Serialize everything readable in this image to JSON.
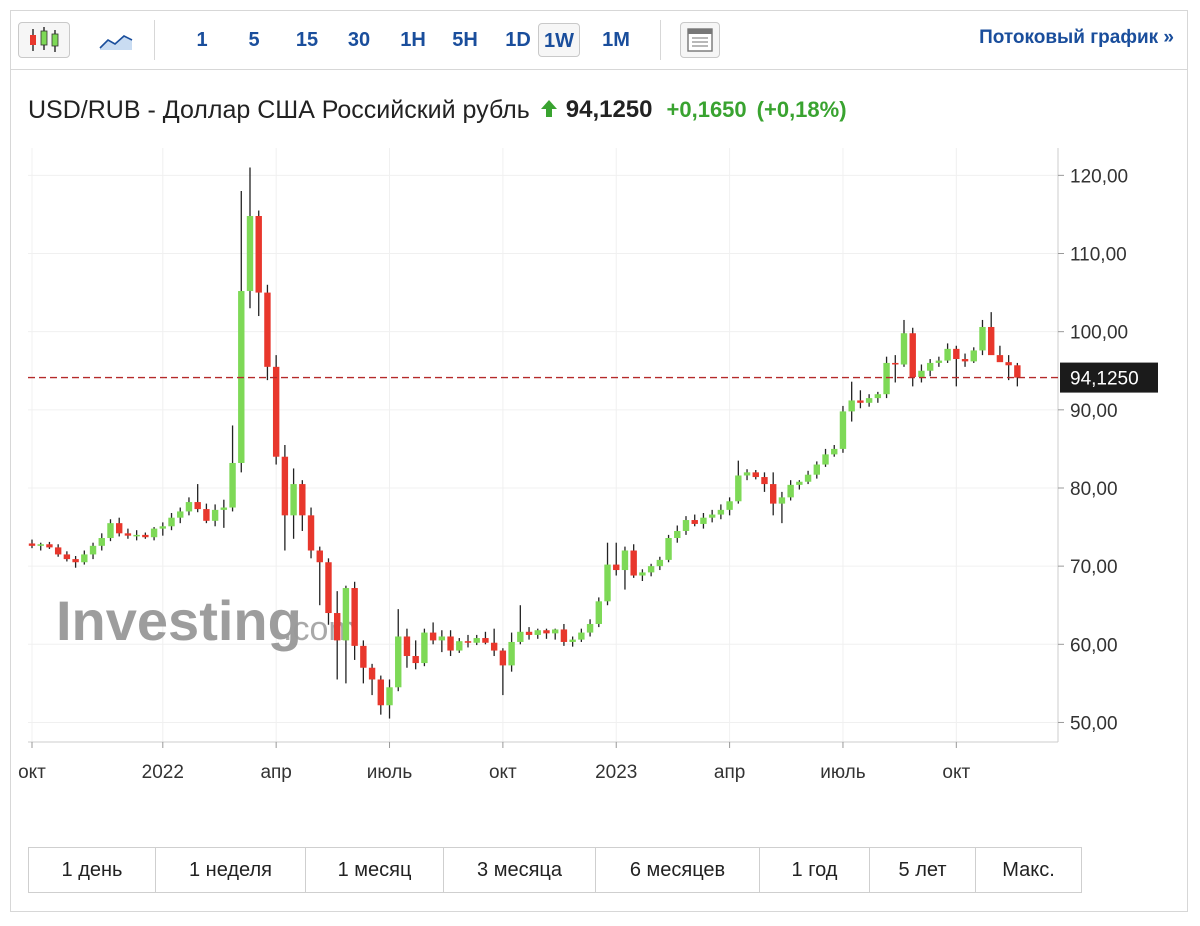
{
  "toolbar": {
    "candles_icon": "candlestick-chart-icon",
    "area_icon": "area-chart-icon",
    "layout_icon": "layout-panel-icon",
    "timeframes": [
      "1",
      "5",
      "15",
      "30",
      "1H",
      "5H",
      "1D",
      "1W",
      "1M"
    ],
    "active_timeframe": "1W",
    "stream_link": "Потоковый график »"
  },
  "header": {
    "pair": "USD/RUB - Доллар США Российский рубль",
    "price": "94,1250",
    "change": "+0,1650",
    "change_pct": "(+0,18%)"
  },
  "watermark": {
    "brand": "Investing",
    "suffix": ".com"
  },
  "colors": {
    "up": "#7ed957",
    "down": "#e8372c",
    "wick": "#222222",
    "link": "#1a4e9c",
    "change": "#39a330",
    "price_line": "#b52a2a"
  },
  "chart_data": {
    "type": "candlestick",
    "ylim": [
      47.5,
      123.5
    ],
    "y_ticks": [
      "50,00",
      "60,00",
      "70,00",
      "80,00",
      "90,00",
      "100,00",
      "110,00",
      "120,00"
    ],
    "y_tick_values": [
      50,
      60,
      70,
      80,
      90,
      100,
      110,
      120
    ],
    "x_ticks": [
      {
        "label": "окт",
        "week": 0
      },
      {
        "label": "2022",
        "week": 15
      },
      {
        "label": "апр",
        "week": 28
      },
      {
        "label": "июль",
        "week": 41
      },
      {
        "label": "окт",
        "week": 54
      },
      {
        "label": "2023",
        "week": 67
      },
      {
        "label": "апр",
        "week": 80
      },
      {
        "label": "июль",
        "week": 93
      },
      {
        "label": "окт",
        "week": 106
      }
    ],
    "last_price": 94.125,
    "last_price_label": "94,1250",
    "candles": [
      [
        72.9,
        73.4,
        72.3,
        72.6
      ],
      [
        72.6,
        73.0,
        72.0,
        72.8
      ],
      [
        72.8,
        73.1,
        72.2,
        72.4
      ],
      [
        72.4,
        72.8,
        71.2,
        71.5
      ],
      [
        71.5,
        71.9,
        70.6,
        70.9
      ],
      [
        70.9,
        71.3,
        69.8,
        70.5
      ],
      [
        70.5,
        72.0,
        70.2,
        71.5
      ],
      [
        71.5,
        73.0,
        70.9,
        72.6
      ],
      [
        72.6,
        74.2,
        72.0,
        73.6
      ],
      [
        73.6,
        76.0,
        73.2,
        75.5
      ],
      [
        75.5,
        76.2,
        73.8,
        74.2
      ],
      [
        74.2,
        74.8,
        73.5,
        73.9
      ],
      [
        73.9,
        74.6,
        73.3,
        74.0
      ],
      [
        74.0,
        74.3,
        73.5,
        73.7
      ],
      [
        73.7,
        75.0,
        73.3,
        74.8
      ],
      [
        74.8,
        75.6,
        73.9,
        75.1
      ],
      [
        75.1,
        76.8,
        74.6,
        76.2
      ],
      [
        76.2,
        77.5,
        75.5,
        77.0
      ],
      [
        77.0,
        78.8,
        76.5,
        78.2
      ],
      [
        78.2,
        80.5,
        76.9,
        77.3
      ],
      [
        77.3,
        78.0,
        75.5,
        75.8
      ],
      [
        75.8,
        77.9,
        75.1,
        77.2
      ],
      [
        77.2,
        78.5,
        74.9,
        77.5
      ],
      [
        77.5,
        88.0,
        77.0,
        83.2
      ],
      [
        83.2,
        118.0,
        82.0,
        105.2
      ],
      [
        105.2,
        121.0,
        103.0,
        114.8
      ],
      [
        114.8,
        115.5,
        102.0,
        105.0
      ],
      [
        105.0,
        106.0,
        93.8,
        95.5
      ],
      [
        95.5,
        97.0,
        83.0,
        84.0
      ],
      [
        84.0,
        85.5,
        72.0,
        76.5
      ],
      [
        76.5,
        82.5,
        73.5,
        80.5
      ],
      [
        80.5,
        81.0,
        74.5,
        76.5
      ],
      [
        76.5,
        77.5,
        71.0,
        72.0
      ],
      [
        72.0,
        72.5,
        65.0,
        70.5
      ],
      [
        70.5,
        71.0,
        62.5,
        64.0
      ],
      [
        64.0,
        66.8,
        55.5,
        60.5
      ],
      [
        60.5,
        67.5,
        55.0,
        67.2
      ],
      [
        67.2,
        68.0,
        58.0,
        59.8
      ],
      [
        59.8,
        60.5,
        55.0,
        57.0
      ],
      [
        57.0,
        57.5,
        53.5,
        55.5
      ],
      [
        55.5,
        56.0,
        51.0,
        52.2
      ],
      [
        52.2,
        55.5,
        50.5,
        54.5
      ],
      [
        54.5,
        64.5,
        54.0,
        61.0
      ],
      [
        61.0,
        62.0,
        57.0,
        58.5
      ],
      [
        58.5,
        60.5,
        56.8,
        57.6
      ],
      [
        57.6,
        62.0,
        57.2,
        61.5
      ],
      [
        61.5,
        62.8,
        60.0,
        60.5
      ],
      [
        60.5,
        61.8,
        59.0,
        61.0
      ],
      [
        61.0,
        61.8,
        58.5,
        59.2
      ],
      [
        59.2,
        60.8,
        58.9,
        60.4
      ],
      [
        60.4,
        61.2,
        59.6,
        60.2
      ],
      [
        60.2,
        61.2,
        59.9,
        60.8
      ],
      [
        60.8,
        61.6,
        60.0,
        60.2
      ],
      [
        60.2,
        62.0,
        58.5,
        59.2
      ],
      [
        59.2,
        59.5,
        53.5,
        57.3
      ],
      [
        57.3,
        61.5,
        56.5,
        60.3
      ],
      [
        60.3,
        65.0,
        60.0,
        61.6
      ],
      [
        61.6,
        62.2,
        60.6,
        61.2
      ],
      [
        61.2,
        62.0,
        60.7,
        61.8
      ],
      [
        61.8,
        62.0,
        60.7,
        61.4
      ],
      [
        61.4,
        62.0,
        60.6,
        61.9
      ],
      [
        61.9,
        62.6,
        59.8,
        60.3
      ],
      [
        60.3,
        61.0,
        59.7,
        60.6
      ],
      [
        60.6,
        62.0,
        60.3,
        61.5
      ],
      [
        61.5,
        63.2,
        61.0,
        62.6
      ],
      [
        62.6,
        66.0,
        62.2,
        65.5
      ],
      [
        65.5,
        73.0,
        65.0,
        70.2
      ],
      [
        70.2,
        73.0,
        68.8,
        69.5
      ],
      [
        69.5,
        72.5,
        67.0,
        72.0
      ],
      [
        72.0,
        72.8,
        68.5,
        68.8
      ],
      [
        68.8,
        69.6,
        68.1,
        69.2
      ],
      [
        69.2,
        70.3,
        68.7,
        70.0
      ],
      [
        70.0,
        71.2,
        69.5,
        70.8
      ],
      [
        70.8,
        74.0,
        70.5,
        73.6
      ],
      [
        73.6,
        75.2,
        73.0,
        74.5
      ],
      [
        74.5,
        76.4,
        74.0,
        75.9
      ],
      [
        75.9,
        76.6,
        75.1,
        75.4
      ],
      [
        75.4,
        76.8,
        74.8,
        76.2
      ],
      [
        76.2,
        77.2,
        75.6,
        76.6
      ],
      [
        76.6,
        77.9,
        76.0,
        77.2
      ],
      [
        77.2,
        78.8,
        76.5,
        78.3
      ],
      [
        78.3,
        83.5,
        78.0,
        81.6
      ],
      [
        81.6,
        82.4,
        81.0,
        82.0
      ],
      [
        82.0,
        82.3,
        81.1,
        81.4
      ],
      [
        81.4,
        82.0,
        79.5,
        80.5
      ],
      [
        80.5,
        82.0,
        76.5,
        78.0
      ],
      [
        78.0,
        79.5,
        75.5,
        78.8
      ],
      [
        78.8,
        81.0,
        78.4,
        80.4
      ],
      [
        80.4,
        81.0,
        79.8,
        80.8
      ],
      [
        80.8,
        82.2,
        80.5,
        81.7
      ],
      [
        81.7,
        83.4,
        81.2,
        83.0
      ],
      [
        83.0,
        85.0,
        82.7,
        84.3
      ],
      [
        84.3,
        85.5,
        84.0,
        85.0
      ],
      [
        85.0,
        90.5,
        84.5,
        89.8
      ],
      [
        89.8,
        93.6,
        88.5,
        91.2
      ],
      [
        91.2,
        92.5,
        90.2,
        90.9
      ],
      [
        90.9,
        92.0,
        90.4,
        91.5
      ],
      [
        91.5,
        92.3,
        90.9,
        92.0
      ],
      [
        92.0,
        96.8,
        91.5,
        96.0
      ],
      [
        96.0,
        97.0,
        93.5,
        95.8
      ],
      [
        95.8,
        101.5,
        95.5,
        99.8
      ],
      [
        99.8,
        100.5,
        93.0,
        94.2
      ],
      [
        94.2,
        95.8,
        93.5,
        95.0
      ],
      [
        95.0,
        96.5,
        94.3,
        96.0
      ],
      [
        96.0,
        96.8,
        95.5,
        96.3
      ],
      [
        96.3,
        98.5,
        96.0,
        97.8
      ],
      [
        97.8,
        98.2,
        93.0,
        96.5
      ],
      [
        96.5,
        97.2,
        95.5,
        96.2
      ],
      [
        96.2,
        98.0,
        96.0,
        97.6
      ],
      [
        97.6,
        101.5,
        97.0,
        100.6
      ],
      [
        100.6,
        102.5,
        97.5,
        97.0
      ],
      [
        97.0,
        98.2,
        96.5,
        96.1
      ],
      [
        96.1,
        97.0,
        93.8,
        95.7
      ],
      [
        95.7,
        96.0,
        93.0,
        94.125
      ]
    ]
  },
  "periods": [
    "1 день",
    "1 неделя",
    "1 месяц",
    "3 месяца",
    "6 месяцев",
    "1 год",
    "5 лет",
    "Макс."
  ]
}
